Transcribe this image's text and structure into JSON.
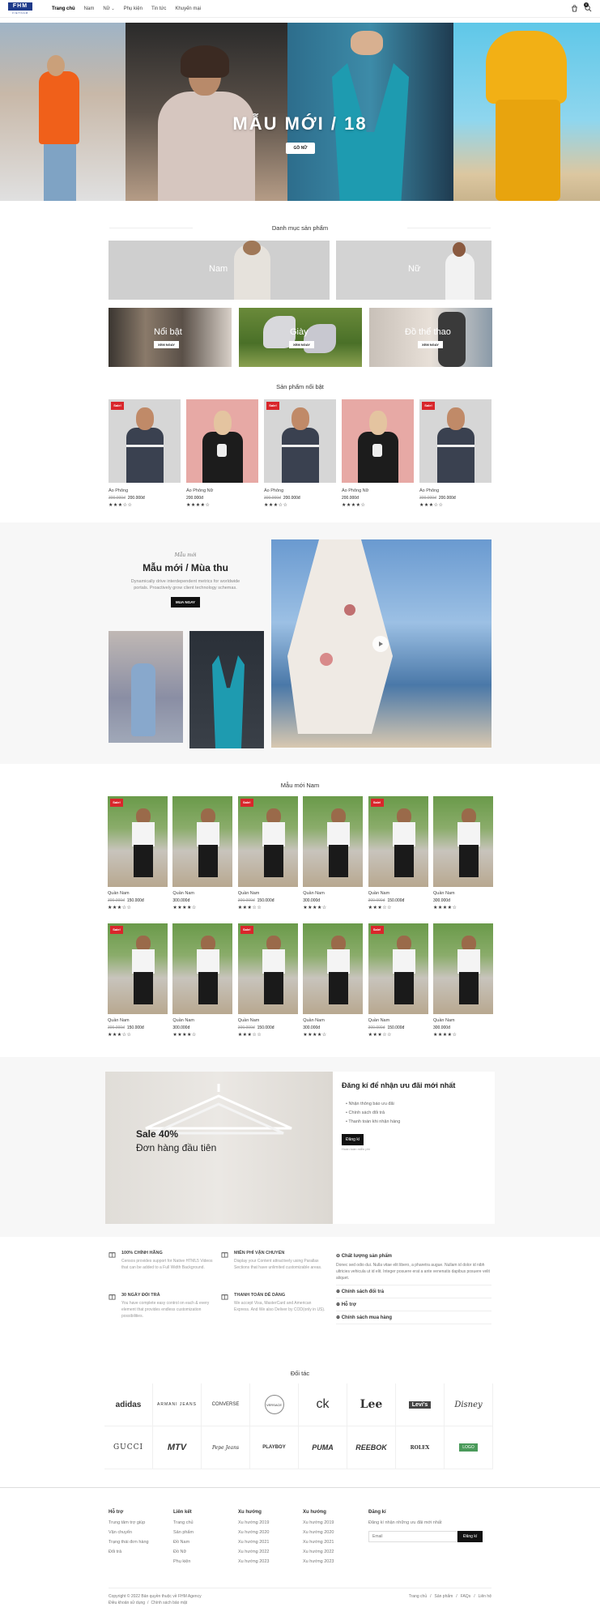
{
  "brand": {
    "logo_text": "FHM",
    "logo_sub": "VIETNAM"
  },
  "nav": {
    "items": [
      {
        "label": "Trang chủ",
        "active": true
      },
      {
        "label": "Nam"
      },
      {
        "label": "Nữ",
        "has_dropdown": true
      },
      {
        "label": "Phụ kiện"
      },
      {
        "label": "Tin tức"
      },
      {
        "label": "Khuyến mại"
      }
    ],
    "cart_count": "0",
    "icons": [
      "cart-icon",
      "search-icon"
    ]
  },
  "hero": {
    "title": "MẪU MỚI / 18",
    "button": "GỒ NỮ"
  },
  "categories": {
    "heading": "Danh mục sản phẩm",
    "big": [
      {
        "label": "Nam"
      },
      {
        "label": "Nữ"
      }
    ],
    "small": [
      {
        "label": "Nổi bật",
        "button": "XEM NGAY"
      },
      {
        "label": "Giày",
        "button": "XEM NGAY"
      },
      {
        "label": "Đồ thể thao",
        "button": "XEM NGAY"
      }
    ]
  },
  "featured": {
    "heading": "Sản phẩm nổi bật",
    "products": [
      {
        "name": "Áo Phông",
        "old_price": "300.000đ",
        "price": "200.000đ",
        "sale": "Sale!",
        "rating": 3
      },
      {
        "name": "Áo Phông Nữ",
        "old_price": "",
        "price": "200.000đ",
        "sale": "",
        "rating": 4
      },
      {
        "name": "Áo Phông",
        "old_price": "300.000đ",
        "price": "200.000đ",
        "sale": "Sale!",
        "rating": 3
      },
      {
        "name": "Áo Phông Nữ",
        "old_price": "",
        "price": "200.000đ",
        "sale": "",
        "rating": 4
      },
      {
        "name": "Áo Phông",
        "old_price": "300.000đ",
        "price": "200.000đ",
        "sale": "Sale!",
        "rating": 3
      }
    ]
  },
  "new_collection": {
    "eyebrow": "Mẫu mới",
    "title": "Mẫu mới / Mùa thu",
    "desc": "Dynamically drive interdependent metrics for worldwide portals. Proactively grow client technology schemas.",
    "button": "MUA NGAY"
  },
  "men": {
    "heading": "Mẫu mới Nam",
    "products": [
      {
        "name": "Quần Nam",
        "old_price": "300.000đ",
        "price": "150.000đ",
        "sale": "Sale!",
        "rating": 3
      },
      {
        "name": "Quần Nam",
        "old_price": "",
        "price": "300.000đ",
        "sale": "",
        "rating": 4
      },
      {
        "name": "Quần Nam",
        "old_price": "300.000đ",
        "price": "150.000đ",
        "sale": "Sale!",
        "rating": 3
      },
      {
        "name": "Quần Nam",
        "old_price": "",
        "price": "300.000đ",
        "sale": "",
        "rating": 4
      },
      {
        "name": "Quần Nam",
        "old_price": "300.000đ",
        "price": "150.000đ",
        "sale": "Sale!",
        "rating": 3
      },
      {
        "name": "Quần Nam",
        "old_price": "",
        "price": "300.000đ",
        "sale": "",
        "rating": 4
      },
      {
        "name": "Quần Nam",
        "old_price": "300.000đ",
        "price": "150.000đ",
        "sale": "Sale!",
        "rating": 3
      },
      {
        "name": "Quần Nam",
        "old_price": "",
        "price": "300.000đ",
        "sale": "",
        "rating": 4
      },
      {
        "name": "Quần Nam",
        "old_price": "300.000đ",
        "price": "150.000đ",
        "sale": "Sale!",
        "rating": 3
      },
      {
        "name": "Quần Nam",
        "old_price": "",
        "price": "300.000đ",
        "sale": "",
        "rating": 4
      },
      {
        "name": "Quần Nam",
        "old_price": "300.000đ",
        "price": "150.000đ",
        "sale": "Sale!",
        "rating": 3
      },
      {
        "name": "Quần Nam",
        "old_price": "",
        "price": "300.000đ",
        "sale": "",
        "rating": 4
      }
    ]
  },
  "promo": {
    "sale_line1": "Sale 40%",
    "sale_line2": "Đơn hàng đầu tiên",
    "nl_title": "Đăng kí để nhận ưu đãi mới nhất",
    "nl_items": [
      "Nhận thông báo ưu đãi",
      "Chính sách đổi trả",
      "Thanh toán khi nhận hàng"
    ],
    "nl_button": "Đăng kí",
    "nl_note": "Hoàn toàn miễn phí"
  },
  "features": {
    "items": [
      {
        "icon": "gift-icon",
        "title": "100% CHÍNH HÃNG",
        "desc": "Censos provides support for Native HTML5 Videos that can be added to a Full Width Background."
      },
      {
        "icon": "globe-icon",
        "title": "MIỄN PHÍ VẬN CHUYỂN",
        "desc": "Display your Content attractively using Parallax Sections that have unlimited customizable areas."
      },
      {
        "icon": "chat-icon",
        "title": "30 NGÀY ĐỔI TRẢ",
        "desc": "You have complete easy control on each & every element that provides endless customization possibilities."
      },
      {
        "icon": "card-icon",
        "title": "THANH TOÁN DỄ DÀNG",
        "desc": "We accept Visa, MasterCard and American Express. And We also Deliver by COD(only in US)."
      }
    ],
    "accordion": [
      {
        "title": "Chất lượng sản phẩm",
        "open": true,
        "body": "Donec sed odio dui. Nulla vitae elit libero, a pharetra augue. Nullam id dolor id nibh ultricies vehicula ut id elit. Integer posuere erat a ante venenatis dapibus posuere velit aliquet."
      },
      {
        "title": "Chính sách đổi trả",
        "open": false
      },
      {
        "title": "Hỗ trợ",
        "open": false
      },
      {
        "title": "Chính sách mua hàng",
        "open": false
      }
    ]
  },
  "partners": {
    "heading": "Đối tác",
    "logos": [
      "adidas",
      "ARMANI JEANS",
      "CONVERSE",
      "VERSACE",
      "ck",
      "Lee",
      "Levi's",
      "Disney",
      "GUCCI",
      "MTV",
      "Pepe Jeans",
      "PLAYBOY",
      "PUMA",
      "REEBOK",
      "ROLEX",
      "LOGO"
    ]
  },
  "footer": {
    "columns": [
      {
        "title": "Hỗ trợ",
        "items": [
          "Trung tâm trợ giúp",
          "Vận chuyển",
          "Trạng thái đơn hàng",
          "Đổi trả"
        ]
      },
      {
        "title": "Liên kết",
        "items": [
          "Trang chủ",
          "Sản phẩm",
          "Đồ Nam",
          "Đồ Nữ",
          "Phụ kiện"
        ]
      },
      {
        "title": "Xu hướng",
        "items": [
          "Xu hướng 2019",
          "Xu hướng 2020",
          "Xu hướng 2021",
          "Xu hướng 2022",
          "Xu hướng 2023"
        ]
      },
      {
        "title": "Xu hướng",
        "items": [
          "Xu hướng 2019",
          "Xu hướng 2020",
          "Xu hướng 2021",
          "Xu hướng 2022",
          "Xu hướng 2023"
        ]
      }
    ],
    "subscribe": {
      "title": "Đăng kí",
      "desc": "Đăng kí nhận những ưu đãi mới nhất",
      "placeholder": "Email",
      "button": "Đăng kí"
    },
    "copyright": "Copyright © 2022 Bản quyền thuộc về FHM Agency",
    "bottom_links": [
      "Điều khoản sử dụng",
      "Chính sách bảo mật"
    ],
    "right_links": [
      "Trang chủ",
      "Sản phẩm",
      "FAQs",
      "Liên hệ"
    ]
  }
}
